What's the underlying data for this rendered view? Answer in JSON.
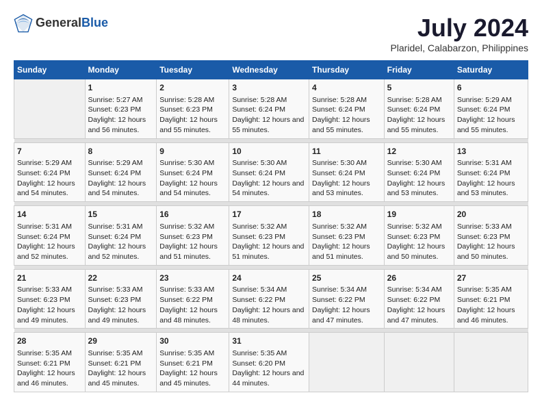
{
  "header": {
    "logo_general": "General",
    "logo_blue": "Blue",
    "title": "July 2024",
    "subtitle": "Plaridel, Calabarzon, Philippines"
  },
  "days_of_week": [
    "Sunday",
    "Monday",
    "Tuesday",
    "Wednesday",
    "Thursday",
    "Friday",
    "Saturday"
  ],
  "weeks": [
    [
      {
        "day": "",
        "sunrise": "",
        "sunset": "",
        "daylight": ""
      },
      {
        "day": "1",
        "sunrise": "Sunrise: 5:27 AM",
        "sunset": "Sunset: 6:23 PM",
        "daylight": "Daylight: 12 hours and 56 minutes."
      },
      {
        "day": "2",
        "sunrise": "Sunrise: 5:28 AM",
        "sunset": "Sunset: 6:23 PM",
        "daylight": "Daylight: 12 hours and 55 minutes."
      },
      {
        "day": "3",
        "sunrise": "Sunrise: 5:28 AM",
        "sunset": "Sunset: 6:24 PM",
        "daylight": "Daylight: 12 hours and 55 minutes."
      },
      {
        "day": "4",
        "sunrise": "Sunrise: 5:28 AM",
        "sunset": "Sunset: 6:24 PM",
        "daylight": "Daylight: 12 hours and 55 minutes."
      },
      {
        "day": "5",
        "sunrise": "Sunrise: 5:28 AM",
        "sunset": "Sunset: 6:24 PM",
        "daylight": "Daylight: 12 hours and 55 minutes."
      },
      {
        "day": "6",
        "sunrise": "Sunrise: 5:29 AM",
        "sunset": "Sunset: 6:24 PM",
        "daylight": "Daylight: 12 hours and 55 minutes."
      }
    ],
    [
      {
        "day": "7",
        "sunrise": "Sunrise: 5:29 AM",
        "sunset": "Sunset: 6:24 PM",
        "daylight": "Daylight: 12 hours and 54 minutes."
      },
      {
        "day": "8",
        "sunrise": "Sunrise: 5:29 AM",
        "sunset": "Sunset: 6:24 PM",
        "daylight": "Daylight: 12 hours and 54 minutes."
      },
      {
        "day": "9",
        "sunrise": "Sunrise: 5:30 AM",
        "sunset": "Sunset: 6:24 PM",
        "daylight": "Daylight: 12 hours and 54 minutes."
      },
      {
        "day": "10",
        "sunrise": "Sunrise: 5:30 AM",
        "sunset": "Sunset: 6:24 PM",
        "daylight": "Daylight: 12 hours and 54 minutes."
      },
      {
        "day": "11",
        "sunrise": "Sunrise: 5:30 AM",
        "sunset": "Sunset: 6:24 PM",
        "daylight": "Daylight: 12 hours and 53 minutes."
      },
      {
        "day": "12",
        "sunrise": "Sunrise: 5:30 AM",
        "sunset": "Sunset: 6:24 PM",
        "daylight": "Daylight: 12 hours and 53 minutes."
      },
      {
        "day": "13",
        "sunrise": "Sunrise: 5:31 AM",
        "sunset": "Sunset: 6:24 PM",
        "daylight": "Daylight: 12 hours and 53 minutes."
      }
    ],
    [
      {
        "day": "14",
        "sunrise": "Sunrise: 5:31 AM",
        "sunset": "Sunset: 6:24 PM",
        "daylight": "Daylight: 12 hours and 52 minutes."
      },
      {
        "day": "15",
        "sunrise": "Sunrise: 5:31 AM",
        "sunset": "Sunset: 6:24 PM",
        "daylight": "Daylight: 12 hours and 52 minutes."
      },
      {
        "day": "16",
        "sunrise": "Sunrise: 5:32 AM",
        "sunset": "Sunset: 6:23 PM",
        "daylight": "Daylight: 12 hours and 51 minutes."
      },
      {
        "day": "17",
        "sunrise": "Sunrise: 5:32 AM",
        "sunset": "Sunset: 6:23 PM",
        "daylight": "Daylight: 12 hours and 51 minutes."
      },
      {
        "day": "18",
        "sunrise": "Sunrise: 5:32 AM",
        "sunset": "Sunset: 6:23 PM",
        "daylight": "Daylight: 12 hours and 51 minutes."
      },
      {
        "day": "19",
        "sunrise": "Sunrise: 5:32 AM",
        "sunset": "Sunset: 6:23 PM",
        "daylight": "Daylight: 12 hours and 50 minutes."
      },
      {
        "day": "20",
        "sunrise": "Sunrise: 5:33 AM",
        "sunset": "Sunset: 6:23 PM",
        "daylight": "Daylight: 12 hours and 50 minutes."
      }
    ],
    [
      {
        "day": "21",
        "sunrise": "Sunrise: 5:33 AM",
        "sunset": "Sunset: 6:23 PM",
        "daylight": "Daylight: 12 hours and 49 minutes."
      },
      {
        "day": "22",
        "sunrise": "Sunrise: 5:33 AM",
        "sunset": "Sunset: 6:23 PM",
        "daylight": "Daylight: 12 hours and 49 minutes."
      },
      {
        "day": "23",
        "sunrise": "Sunrise: 5:33 AM",
        "sunset": "Sunset: 6:22 PM",
        "daylight": "Daylight: 12 hours and 48 minutes."
      },
      {
        "day": "24",
        "sunrise": "Sunrise: 5:34 AM",
        "sunset": "Sunset: 6:22 PM",
        "daylight": "Daylight: 12 hours and 48 minutes."
      },
      {
        "day": "25",
        "sunrise": "Sunrise: 5:34 AM",
        "sunset": "Sunset: 6:22 PM",
        "daylight": "Daylight: 12 hours and 47 minutes."
      },
      {
        "day": "26",
        "sunrise": "Sunrise: 5:34 AM",
        "sunset": "Sunset: 6:22 PM",
        "daylight": "Daylight: 12 hours and 47 minutes."
      },
      {
        "day": "27",
        "sunrise": "Sunrise: 5:35 AM",
        "sunset": "Sunset: 6:21 PM",
        "daylight": "Daylight: 12 hours and 46 minutes."
      }
    ],
    [
      {
        "day": "28",
        "sunrise": "Sunrise: 5:35 AM",
        "sunset": "Sunset: 6:21 PM",
        "daylight": "Daylight: 12 hours and 46 minutes."
      },
      {
        "day": "29",
        "sunrise": "Sunrise: 5:35 AM",
        "sunset": "Sunset: 6:21 PM",
        "daylight": "Daylight: 12 hours and 45 minutes."
      },
      {
        "day": "30",
        "sunrise": "Sunrise: 5:35 AM",
        "sunset": "Sunset: 6:21 PM",
        "daylight": "Daylight: 12 hours and 45 minutes."
      },
      {
        "day": "31",
        "sunrise": "Sunrise: 5:35 AM",
        "sunset": "Sunset: 6:20 PM",
        "daylight": "Daylight: 12 hours and 44 minutes."
      },
      {
        "day": "",
        "sunrise": "",
        "sunset": "",
        "daylight": ""
      },
      {
        "day": "",
        "sunrise": "",
        "sunset": "",
        "daylight": ""
      },
      {
        "day": "",
        "sunrise": "",
        "sunset": "",
        "daylight": ""
      }
    ]
  ]
}
